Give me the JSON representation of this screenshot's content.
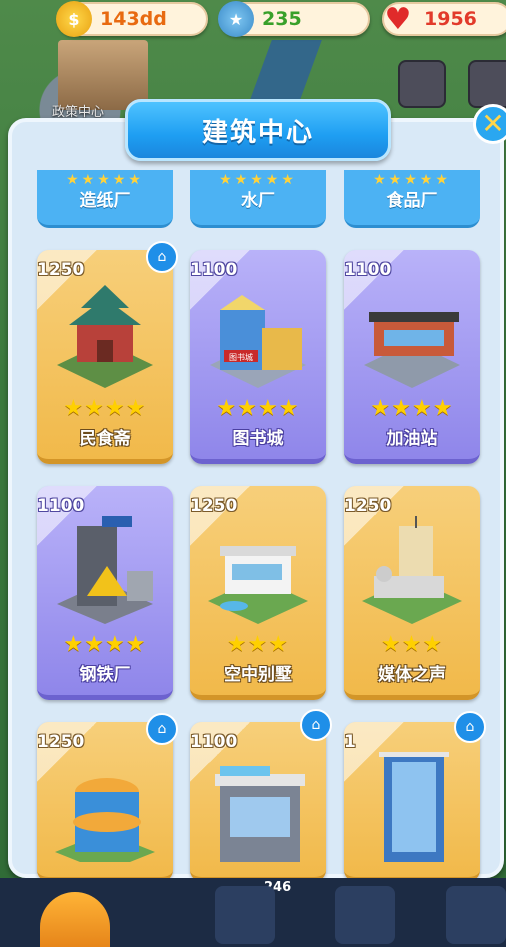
{
  "resources": {
    "coins": "143dd",
    "stars": "235",
    "hearts": "1956"
  },
  "background": {
    "building_label": "政策中心"
  },
  "dialog": {
    "title": "建筑中心",
    "close_icon": "close-icon"
  },
  "top_row": [
    {
      "name": "造纸厂"
    },
    {
      "name": "水厂"
    },
    {
      "name": "食品厂"
    }
  ],
  "cards": [
    {
      "cost": "1250",
      "name": "民食斋",
      "style": "gold",
      "stars": "★★★★",
      "badge": true
    },
    {
      "cost": "1100",
      "name": "图书城",
      "style": "purple",
      "stars": "★★★★",
      "badge": false,
      "sign": "图书城"
    },
    {
      "cost": "1100",
      "name": "加油站",
      "style": "purple",
      "stars": "★★★★",
      "badge": false
    },
    {
      "cost": "1100",
      "name": "钢铁厂",
      "style": "purple",
      "stars": "★★★★",
      "badge": false
    },
    {
      "cost": "1250",
      "name": "空中别墅",
      "style": "gold",
      "stars": "★★★",
      "badge": false
    },
    {
      "cost": "1250",
      "name": "媒体之声",
      "style": "gold",
      "stars": "★★★",
      "badge": false
    },
    {
      "cost": "1250",
      "name": "",
      "style": "gold",
      "stars": "",
      "badge": true
    },
    {
      "cost": "1100",
      "name": "",
      "style": "gold",
      "stars": "",
      "badge": true
    },
    {
      "cost": "1",
      "name": "",
      "style": "gold",
      "stars": "",
      "badge": true
    }
  ],
  "bottom_bar": {
    "count": "246"
  },
  "colors": {
    "panel": "#d9e9f7",
    "title_blue": "#1e9ef2",
    "gold_card": "#f1b94a",
    "purple_card": "#8f86ea"
  }
}
